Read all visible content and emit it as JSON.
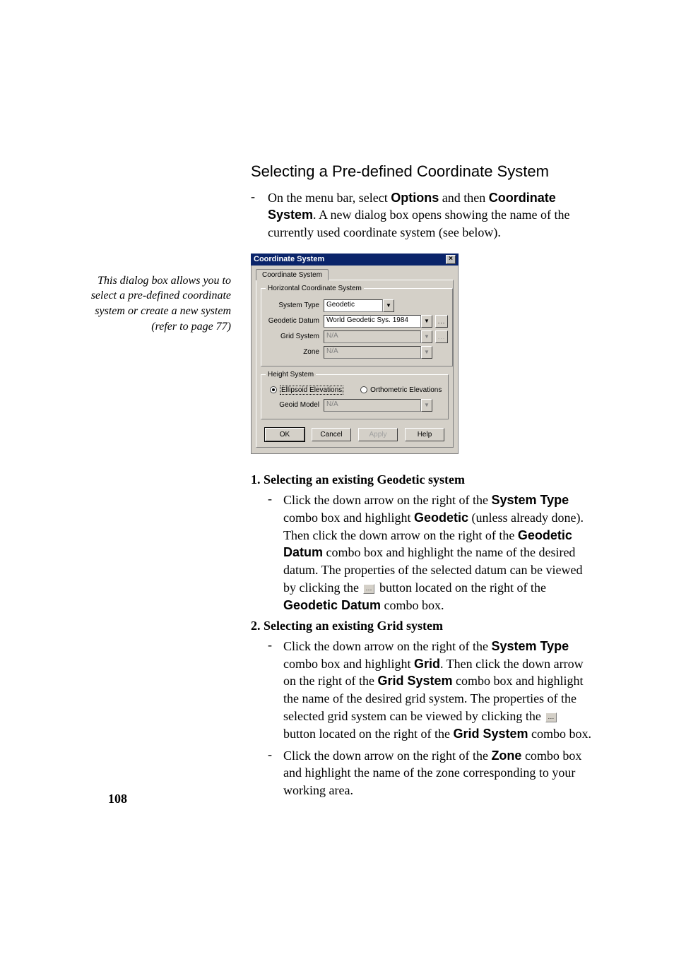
{
  "heading": "Selecting a Pre-defined Coordinate System",
  "intro": {
    "bullet": "-",
    "t1": "On the menu bar, select ",
    "b1": "Options",
    "t2": " and then ",
    "b2": "Coordinate System",
    "t3": ". A new dialog box opens showing the name of the currently used coordinate system (see below)."
  },
  "side_note": "This dialog box allows you to select a pre-defined coordinate system or create a new system (refer to page 77)",
  "dialog": {
    "title": "Coordinate System",
    "close_glyph": "×",
    "tab": "Coordinate System",
    "hcs_legend": "Horizontal Coordinate System",
    "system_type_label": "System Type",
    "system_type_value": "Geodetic",
    "datum_label": "Geodetic Datum",
    "datum_value": "World Geodetic Sys. 1984",
    "grid_label": "Grid System",
    "grid_value": "N/A",
    "zone_label": "Zone",
    "zone_value": "N/A",
    "hs_legend": "Height System",
    "radio_ellipsoid": "Ellipsoid Elevations",
    "radio_ortho": "Orthometric Elevations",
    "geoid_label": "Geoid Model",
    "geoid_value": "N/A",
    "btn_ok": "OK",
    "btn_cancel": "Cancel",
    "btn_apply": "Apply",
    "btn_help": "Help",
    "arrow": "▼",
    "props": "..."
  },
  "sections": [
    {
      "num": "1.",
      "title": "Selecting an existing Geodetic system",
      "items": [
        {
          "bullet": "-",
          "runs": [
            {
              "t": "Click the down arrow on the right of the "
            },
            {
              "t": "System Type",
              "b": true,
              "sans": true
            },
            {
              "t": " combo box and highlight "
            },
            {
              "t": "Geodetic",
              "b": true,
              "sans": true
            },
            {
              "t": " (unless already done). Then click the down arrow on the right of the "
            },
            {
              "t": "Geodetic Datum",
              "b": true,
              "sans": true
            },
            {
              "t": " combo box and highlight the name of the desired datum. The properties of the selected datum can be viewed by clicking the "
            },
            {
              "props": true
            },
            {
              "t": " button located on the right of the "
            },
            {
              "t": "Geodetic Datum",
              "b": true,
              "sans": true
            },
            {
              "t": " combo box."
            }
          ]
        }
      ]
    },
    {
      "num": "2.",
      "title": "Selecting an existing Grid system",
      "items": [
        {
          "bullet": "-",
          "runs": [
            {
              "t": "Click the down arrow on the right of the "
            },
            {
              "t": "System Type",
              "b": true,
              "sans": true
            },
            {
              "t": " combo box and highlight "
            },
            {
              "t": "Grid",
              "b": true,
              "sans": true
            },
            {
              "t": ". Then click the down arrow on the right of the "
            },
            {
              "t": "Grid System",
              "b": true,
              "sans": true
            },
            {
              "t": " combo box and highlight the name of the desired grid system. The properties of the selected grid system can be viewed by clicking the "
            },
            {
              "props": true
            },
            {
              "t": " button located on the right of the "
            },
            {
              "t": "Grid System",
              "b": true,
              "sans": true
            },
            {
              "t": " combo box."
            }
          ]
        },
        {
          "bullet": "-",
          "runs": [
            {
              "t": "Click the down arrow on the right of the "
            },
            {
              "t": "Zone",
              "b": true,
              "sans": true
            },
            {
              "t": " combo box and highlight the name of the zone corresponding to your working area."
            }
          ]
        }
      ]
    }
  ],
  "page_number": "108"
}
